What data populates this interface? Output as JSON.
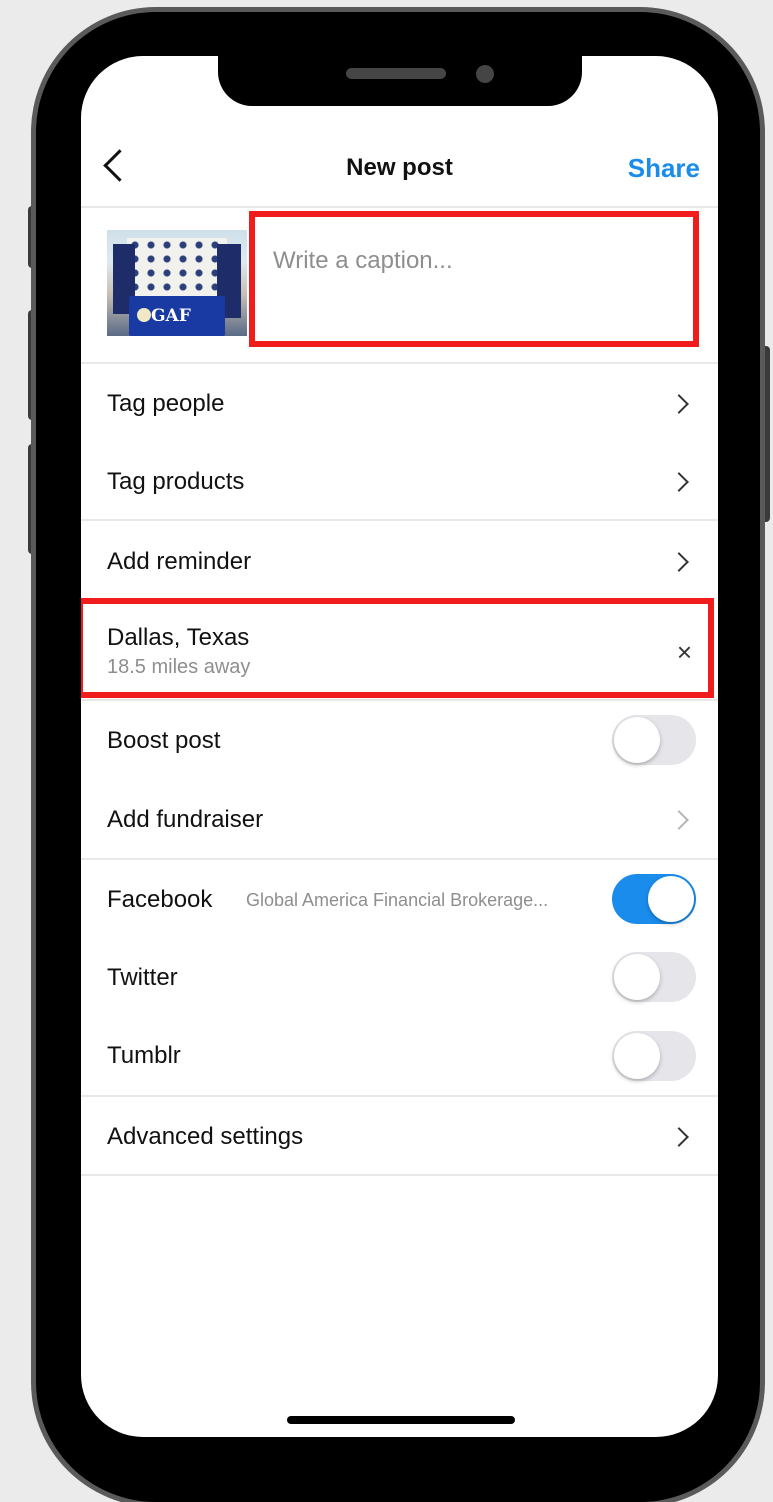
{
  "header": {
    "title": "New post",
    "share_label": "Share"
  },
  "caption": {
    "placeholder": "Write a caption...",
    "value": ""
  },
  "thumbnail": {
    "logo_text": "GAF"
  },
  "rows": {
    "tag_people": "Tag people",
    "tag_products": "Tag products",
    "add_reminder": "Add reminder",
    "location": {
      "name": "Dallas, Texas",
      "distance": "18.5 miles away"
    },
    "boost_post": {
      "label": "Boost post",
      "enabled": false
    },
    "add_fundraiser": "Add fundraiser",
    "facebook": {
      "label": "Facebook",
      "account": "Global America Financial Brokerage...",
      "enabled": true
    },
    "twitter": {
      "label": "Twitter",
      "enabled": false
    },
    "tumblr": {
      "label": "Tumblr",
      "enabled": false
    },
    "advanced_settings": "Advanced settings"
  },
  "colors": {
    "accent": "#1a8cec",
    "highlight": "#f11c1c"
  }
}
